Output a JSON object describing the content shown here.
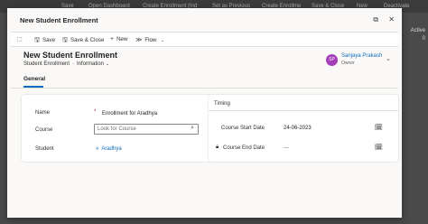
{
  "background_app": {
    "commands": [
      "Save",
      "Open Dashboard",
      "Create Enrollment (Ind",
      "Set as Previous",
      "Create Enrollme",
      "Save & Close",
      "New",
      "Deactivate"
    ],
    "right_texts": [
      "Active",
      "0"
    ]
  },
  "dialog": {
    "title": "New Student Enrollment",
    "icons": [
      "open-in-new-window-icon",
      "close-icon"
    ]
  },
  "commandbar": {
    "save": "Save",
    "save_close": "Save & Close",
    "new": "New",
    "flow": "Flow"
  },
  "record": {
    "title": "New Student Enrollment",
    "entity": "Student Enrollment",
    "form": "Information"
  },
  "owner": {
    "initials": "SP",
    "name": "Sanjaya Prakash",
    "role": "Owner",
    "color": "#a33fb8"
  },
  "tabs": {
    "general": "General"
  },
  "main_section": {
    "name_label": "Name",
    "name_value": "Enrollment for Aradhya",
    "course_label": "Course",
    "course_placeholder": "Look for Course",
    "student_label": "Student",
    "student_value": "Aradhya"
  },
  "timing_section": {
    "title": "Timing",
    "start_label": "Course Start Date",
    "start_value": "24-06-2023",
    "end_label": "Course End Date",
    "end_value": "---"
  },
  "colors": {
    "accent": "#0f6cbd",
    "required": "#a4262c"
  }
}
